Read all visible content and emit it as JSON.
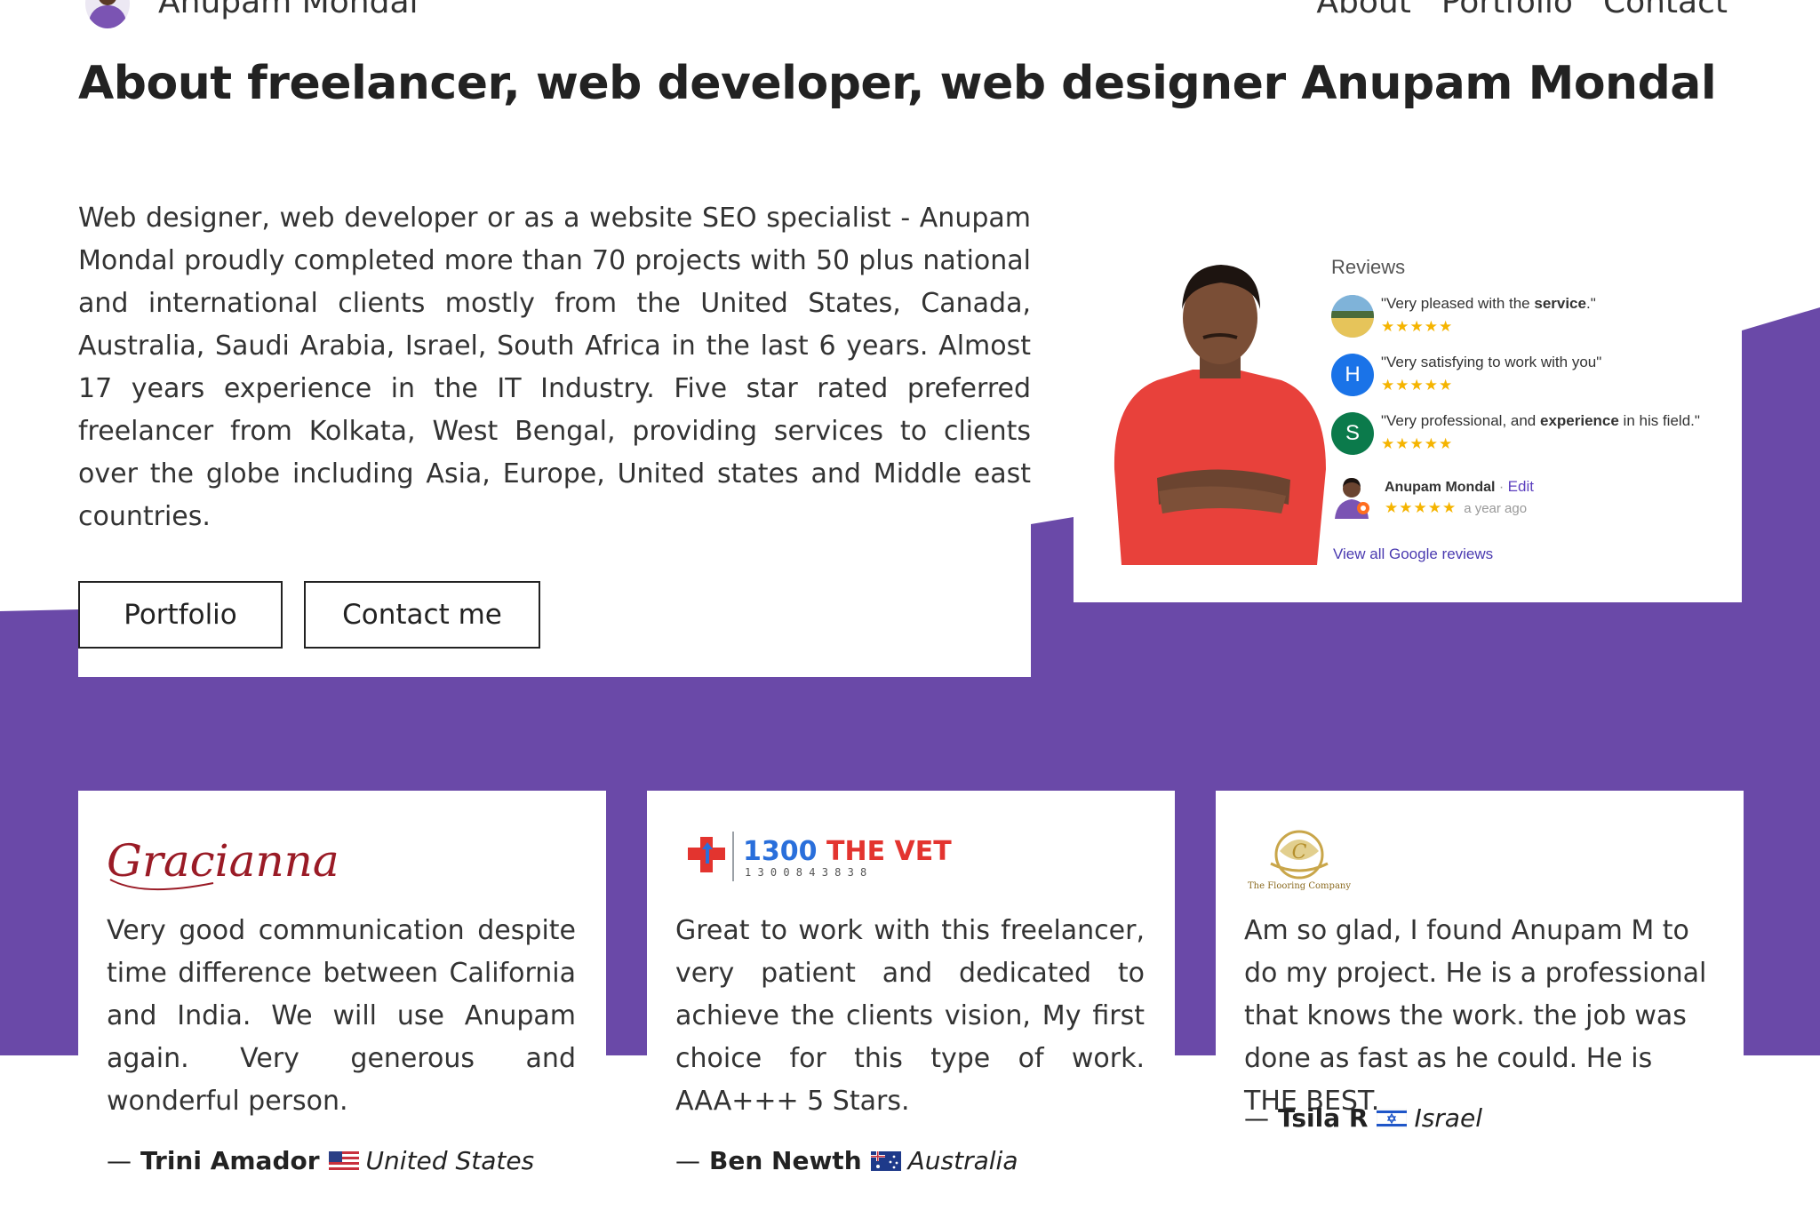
{
  "header": {
    "site_name": "Anupam Mondal",
    "nav": [
      "About",
      "Portfolio",
      "Contact"
    ]
  },
  "page": {
    "title": "About freelancer, web developer, web designer Anupam Mondal",
    "intro": "Web designer, web developer or as a website SEO specialist - Anupam Mondal proudly completed more than 70 projects with 50 plus national and international clients mostly from the United States, Canada, Australia, Saudi Arabia, Israel, South Africa in the last 6 years. Almost 17 years experience in the IT Industry. Five star rated preferred freelancer from Kolkata, West Bengal, providing services to clients over the globe including Asia, Europe, United states and Middle east countries.",
    "buttons": {
      "portfolio": "Portfolio",
      "contact": "Contact me"
    }
  },
  "reviews": {
    "title": "Reviews",
    "items": [
      {
        "avatar": "photo",
        "text_before": "\"Very pleased with the ",
        "text_bold": "service",
        "text_after": ".\"",
        "stars": "★★★★★"
      },
      {
        "avatar": "H",
        "avatar_color": "#1a73e8",
        "text_before": "\"Very satisfying to work with you\"",
        "text_bold": "",
        "text_after": "",
        "stars": "★★★★★"
      },
      {
        "avatar": "S",
        "avatar_color": "#0b7a4b",
        "text_before": "\"Very professional, and ",
        "text_bold": "experience",
        "text_after": " in his field.\"",
        "stars": "★★★★★"
      }
    ],
    "owner": {
      "name": "Anupam Mondal",
      "separator": "·",
      "edit": "Edit",
      "stars": "★★★★★",
      "ago": "a year ago"
    },
    "view_all": "View all Google reviews"
  },
  "testimonials": [
    {
      "logo_text": "Gracianna",
      "quote": "Very good communication despite time difference between California and India. We will use Anupam again. Very generous and wonderful person.",
      "dash": "—",
      "name": "Trini Amador",
      "country": "United States",
      "flag": "us-flag"
    },
    {
      "logo_text": "1300 THE VET",
      "logo_sub": "1 3 0 0 8 4 3 8 3 8",
      "quote": "Great to work with this freelancer, very patient and dedicated to achieve the clients vision, My first choice for this type of work. AAA+++ 5 Stars.",
      "dash": "—",
      "name": "Ben Newth",
      "country": "Australia",
      "flag": "au-flag"
    },
    {
      "logo_text": "The Flooring Company",
      "quote": "Am so glad, I found Anupam M to do my project. He is a professional that knows the work. the job was done as fast as he could. He is THE BEST.",
      "dash": "—",
      "name": "Tsila R",
      "country": "Israel",
      "flag": "il-flag"
    }
  ],
  "colors": {
    "accent": "#6a49a8",
    "star": "#f5b400",
    "link": "#4a3ab0",
    "text": "#333333"
  }
}
